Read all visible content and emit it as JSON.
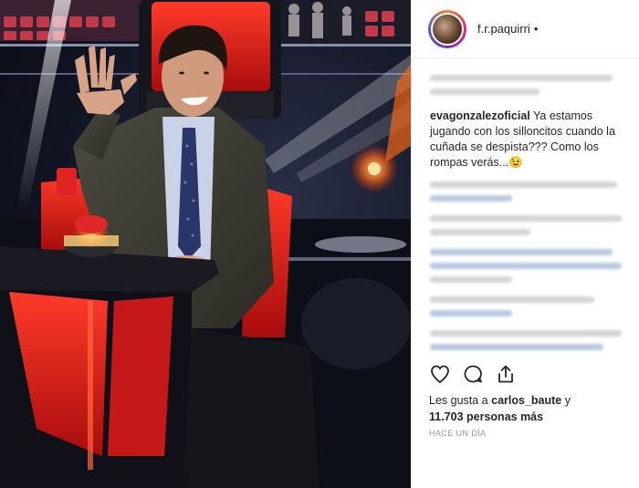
{
  "post": {
    "username": "f.r.paquirri",
    "separator": "•"
  },
  "comment": {
    "author": "evagonzalezoficial",
    "text": "Ya estamos jugando con los silloncitos cuando la cuñada se despista??? Como los rompas verás...😉"
  },
  "likes": {
    "prefix": "Les gusta a",
    "user": "carlos_baute",
    "suffix": "y",
    "count": "11.703 personas más"
  },
  "timestamp": "HACE UN DÍA",
  "icons": {
    "like": "heart-icon",
    "comment": "comment-bubble-icon",
    "share": "share-icon",
    "more": "more-dots"
  },
  "colors": {
    "text": "#262626",
    "muted": "#999999",
    "chair_red": "#d41f1f"
  }
}
